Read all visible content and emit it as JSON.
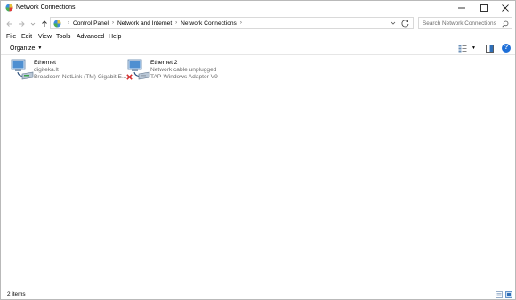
{
  "window": {
    "title": "Network Connections",
    "icon": "network-connections-icon"
  },
  "titlebar_buttons": [
    "minimize",
    "maximize",
    "close"
  ],
  "address_bar": {
    "breadcrumbs": [
      "Control Panel",
      "Network and Internet",
      "Network Connections"
    ],
    "search_placeholder": "Search Network Connections"
  },
  "menu": [
    "File",
    "Edit",
    "View",
    "Tools",
    "Advanced",
    "Help"
  ],
  "command_bar": {
    "organize_label": "Organize"
  },
  "connections": [
    {
      "name": "Ethernet",
      "status": "digiteka.lt",
      "adapter": "Broadcom NetLink (TM) Gigabit E...",
      "disconnected": false
    },
    {
      "name": "Ethernet 2",
      "status": "Network cable unplugged",
      "adapter": "TAP-Windows Adapter V9",
      "disconnected": true
    }
  ],
  "status_bar": {
    "item_count": "2 items"
  },
  "colors": {
    "accent": "#1e6fd8",
    "error": "#d32f2f",
    "secondary_text": "#6d6d6d"
  }
}
